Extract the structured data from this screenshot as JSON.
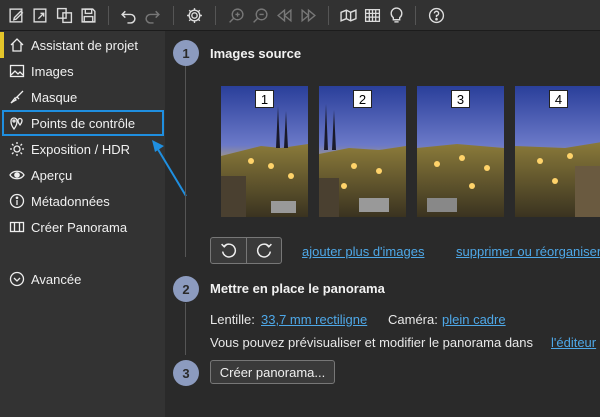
{
  "toolbar": {
    "icons": [
      "edit-icon",
      "export-icon",
      "copy-icon",
      "save-icon",
      "undo-icon",
      "redo-icon",
      "gear-icon",
      "zoom-in-icon",
      "zoom-out-icon",
      "prev-icon",
      "next-icon",
      "panorama-icon",
      "grid-icon",
      "bulb-icon",
      "help-icon"
    ]
  },
  "sidebar": {
    "items": [
      {
        "label": "Assistant de projet",
        "icon": "home-icon"
      },
      {
        "label": "Images",
        "icon": "image-icon"
      },
      {
        "label": "Masque",
        "icon": "brush-icon"
      },
      {
        "label": "Points de contrôle",
        "icon": "pin-icon"
      },
      {
        "label": "Exposition / HDR",
        "icon": "sun-icon"
      },
      {
        "label": "Aperçu",
        "icon": "eye-icon"
      },
      {
        "label": "Métadonnées",
        "icon": "info-icon"
      },
      {
        "label": "Créer Panorama",
        "icon": "panorama-icon"
      }
    ],
    "advanced": {
      "label": "Avancée",
      "icon": "chevron-down-circle-icon"
    }
  },
  "steps": [
    {
      "number": "1",
      "title": "Images source"
    },
    {
      "number": "2",
      "title": "Mettre en place le panorama"
    },
    {
      "number": "3"
    }
  ],
  "images": {
    "thumbnails": [
      "1",
      "2",
      "3",
      "4"
    ],
    "add_link": "ajouter plus d'images",
    "remove_link": "supprimer ou réorganiser"
  },
  "lens": {
    "label": "Lentille:",
    "value": "33,7 mm rectiligne",
    "camera_label": "Caméra:",
    "camera_value": "plein cadre",
    "preview_text": "Vous pouvez prévisualiser et modifier le panorama dans",
    "editor_link": "l'éditeur"
  },
  "create_button": "Créer panorama...",
  "colors": {
    "accent_yellow": "#e4c52a",
    "highlight_blue": "#1f8fe0",
    "link_blue": "#4ea8e8",
    "step_circle": "#8c9bbf"
  }
}
